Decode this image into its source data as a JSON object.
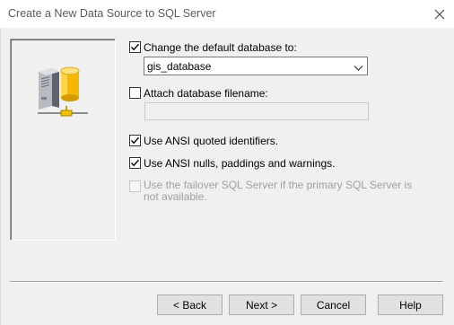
{
  "window": {
    "title": "Create a New Data Source to SQL Server"
  },
  "icons": {
    "close": "close-icon",
    "side": "server-database-icon",
    "dropdown": "chevron-down-icon"
  },
  "options": {
    "change_default_db": {
      "label": "Change the default database to:",
      "checked": true
    },
    "database_select": {
      "value": "gis_database"
    },
    "attach_db_filename": {
      "label": "Attach database filename:",
      "checked": false
    },
    "attach_db_filename_input": {
      "value": ""
    },
    "ansi_quoted": {
      "label": "Use ANSI quoted identifiers.",
      "checked": true
    },
    "ansi_nulls": {
      "label": "Use ANSI nulls, paddings and warnings.",
      "checked": true
    },
    "failover": {
      "label": "Use the failover SQL Server if the primary SQL Server is not available.",
      "checked": false,
      "enabled": false
    }
  },
  "buttons": {
    "back": "< Back",
    "next": "Next >",
    "cancel": "Cancel",
    "help": "Help"
  }
}
